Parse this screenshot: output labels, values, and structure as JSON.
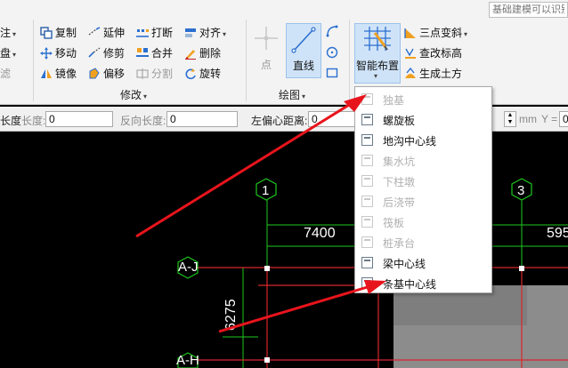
{
  "search": {
    "placeholder": "基础建模可以识别"
  },
  "ribbon": {
    "left_partial": [
      {
        "text": "注",
        "caret": true,
        "dim": false
      },
      {
        "text": "盘",
        "caret": true,
        "dim": false
      },
      {
        "text": "滤",
        "caret": false,
        "dim": true
      }
    ],
    "modify_group": {
      "label": "修改",
      "items": [
        {
          "name": "copy",
          "label": "复制",
          "icon": "copy-icon",
          "dim": false
        },
        {
          "name": "extend",
          "label": "延伸",
          "icon": "extend-icon",
          "dim": false
        },
        {
          "name": "break",
          "label": "打断",
          "icon": "break-icon",
          "dim": false
        },
        {
          "name": "align",
          "label": "对齐",
          "icon": "align-icon",
          "dim": false,
          "caret": true
        },
        {
          "name": "move",
          "label": "移动",
          "icon": "move-icon",
          "dim": false
        },
        {
          "name": "trim",
          "label": "修剪",
          "icon": "trim-icon",
          "dim": false
        },
        {
          "name": "merge",
          "label": "合并",
          "icon": "merge-icon",
          "dim": false
        },
        {
          "name": "delete",
          "label": "删除",
          "icon": "delete-icon",
          "dim": false
        },
        {
          "name": "mirror",
          "label": "镜像",
          "icon": "mirror-icon",
          "dim": false
        },
        {
          "name": "offset",
          "label": "偏移",
          "icon": "offset-icon",
          "dim": false
        },
        {
          "name": "split",
          "label": "分割",
          "icon": "split-icon",
          "dim": true
        },
        {
          "name": "rotate",
          "label": "旋转",
          "icon": "rotate-icon",
          "dim": false
        }
      ]
    },
    "draw_group": {
      "label": "绘图",
      "point_label": "点",
      "line_label": "直线"
    },
    "smart_layout_label": "智能布置",
    "right_items": [
      {
        "label": "三点变斜",
        "caret": true
      },
      {
        "label": "查改标高",
        "caret": false
      },
      {
        "label": "生成土方",
        "caret": false
      }
    ]
  },
  "propbar": {
    "length_label": "长度",
    "length_label2": "长度:",
    "length_value": "0",
    "reverse_length_label": "反向长度:",
    "reverse_length_value": "0",
    "left_offset_label": "左偏心距离:",
    "left_offset_value": "0",
    "mm_label": "mm",
    "y_label": "Y =",
    "y_value": "0"
  },
  "dropdown": {
    "items": [
      {
        "label": "独基",
        "enabled": false
      },
      {
        "label": "螺旋板",
        "enabled": true
      },
      {
        "label": "地沟中心线",
        "enabled": true
      },
      {
        "label": "集水坑",
        "enabled": false
      },
      {
        "label": "下柱墩",
        "enabled": false
      },
      {
        "label": "后浇带",
        "enabled": false
      },
      {
        "label": "筏板",
        "enabled": false
      },
      {
        "label": "桩承台",
        "enabled": false
      },
      {
        "label": "梁中心线",
        "enabled": true
      },
      {
        "label": "条基中心线",
        "enabled": true
      }
    ]
  },
  "canvas": {
    "axis_labels": [
      "1",
      "3"
    ],
    "row_labels": [
      "A-J",
      "A-H"
    ],
    "dimensions": [
      "7400",
      "595",
      "6275"
    ]
  },
  "colors": {
    "annotation_arrow": "#e8141c",
    "grid_green": "#1ec81e",
    "grid_red": "#d8262c",
    "cad_white": "#ffffff",
    "active_button": "#cfe3f8"
  }
}
